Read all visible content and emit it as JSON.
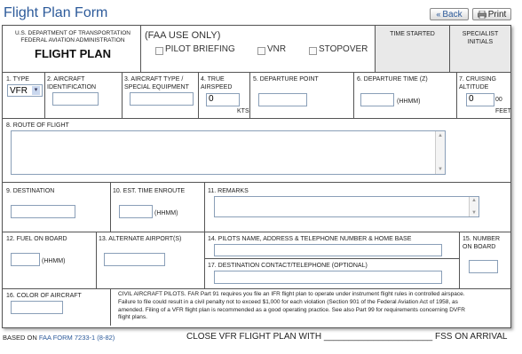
{
  "header": {
    "title": "Flight Plan Form",
    "back_label": "Back",
    "print_label": "Print"
  },
  "agency": {
    "line1": "U.S. DEPARTMENT OF TRANSPORTATION",
    "line2": "FEDERAL AVIATION ADMINISTRATION",
    "form_name": "FLIGHT PLAN"
  },
  "faa_use": {
    "heading": "(FAA USE ONLY)",
    "pilot_briefing": "PILOT BRIEFING",
    "vnr": "VNR",
    "stopover": "STOPOVER",
    "time_started": "TIME STARTED",
    "specialist_initials": "SPECIALIST INITIALS"
  },
  "fields": {
    "type_label": "1. TYPE",
    "type_value": "VFR",
    "aircraft_id_label": "2. AIRCRAFT IDENTIFICATION",
    "aircraft_type_label": "3. AIRCRAFT TYPE / SPECIAL EQUIPMENT",
    "true_airspeed_label": "4. TRUE AIRSPEED",
    "true_airspeed_value": "0",
    "kts": "KTS",
    "departure_point_label": "5. DEPARTURE POINT",
    "departure_time_label": "6. DEPARTURE TIME (Z)",
    "hhmm": "(HHMM)",
    "cruising_altitude_label": "7. CRUISING ALTITUDE",
    "cruising_altitude_value": "0",
    "altitude_suffix": "00",
    "feet": "FEET",
    "route_label": "8. ROUTE OF FLIGHT",
    "destination_label": "9. DESTINATION",
    "est_time_label": "10. EST. TIME ENROUTE",
    "remarks_label": "11. REMARKS",
    "fuel_label": "12. FUEL ON BOARD",
    "alternate_label": "13. ALTERNATE AIRPORT(S)",
    "pilot_info_label": "14. PILOTS NAME, ADDRESS & TELEPHONE NUMBER & HOME BASE",
    "number_on_board_label": "15. NUMBER ON BOARD",
    "destination_contact_label": "17. DESTINATION CONTACT/TELEPHONE (OPTIONAL)",
    "color_label": "16. COLOR OF AIRCRAFT"
  },
  "notice": "CIVIL AIRCRAFT PILOTS. FAR Part 91 requires you file an IFR flight plan to operate under instrument flight rules in controlled airspace. Failure to file could result in a civil penalty not to exceed $1,000 for each violation (Section 901 of the Federal Aviation Act of 1958, as amended. Filing of a VFR flight plan is recommended as a good operating practice. See also Part 99 for requirements concerning DVFR flight plans.",
  "footer": {
    "based_on": "BASED ON",
    "form_ref": "FAA FORM 7233-1 (8-82)",
    "close_text": "CLOSE VFR FLIGHT PLAN WITH ______________________ FSS ON ARRIVAL"
  },
  "colors": {
    "title": "#2c5a9a",
    "link": "#2c5a9a",
    "border": "#555555",
    "input_border": "#8a9fb8"
  }
}
